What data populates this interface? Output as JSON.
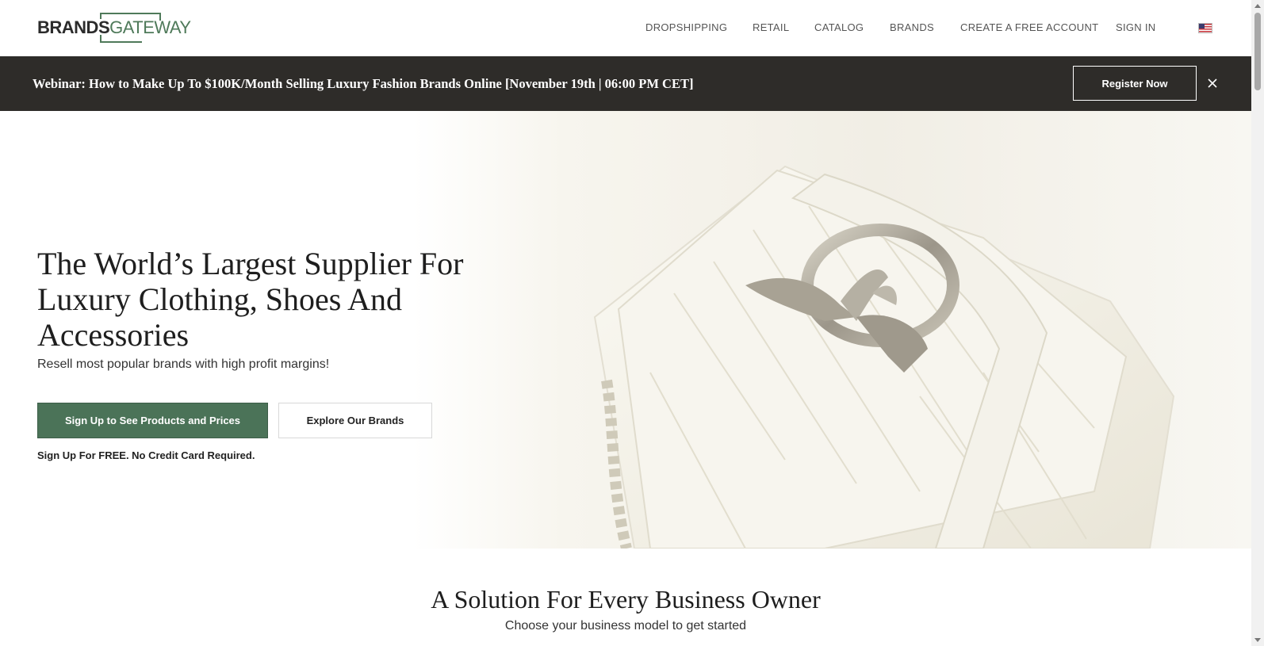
{
  "header": {
    "logo": {
      "part1": "BRANDS",
      "part2": "GATEWAY"
    },
    "nav": [
      {
        "label": "DROPSHIPPING"
      },
      {
        "label": "RETAIL"
      },
      {
        "label": "CATALOG"
      },
      {
        "label": "BRANDS"
      },
      {
        "label": "CREATE A FREE ACCOUNT"
      },
      {
        "label": "SIGN IN"
      }
    ],
    "language_icon": "us-flag-icon"
  },
  "banner": {
    "text": "Webinar: How to Make Up To $100K/Month Selling Luxury Fashion Brands Online [November 19th | 06:00 PM CET]",
    "button": "Register Now",
    "close_icon": "close-icon"
  },
  "hero": {
    "title": "The World’s Largest Supplier For Luxury Clothing, Shoes And Accessories",
    "subtitle": "Resell most popular brands with high profit margins!",
    "primary_button": "Sign Up to See Products and Prices",
    "secondary_button": "Explore Our Brands",
    "note": "Sign Up For FREE. No Credit Card Required.",
    "image_alt": "white quilted leather handbag with silver bird buckle"
  },
  "solutions": {
    "title": "A Solution For Every Business Owner",
    "subtitle": "Choose your business model to get started"
  },
  "colors": {
    "accent_green": "#4b7358",
    "banner_bg": "#2e2c29",
    "logo_green": "#4f7a5a"
  }
}
